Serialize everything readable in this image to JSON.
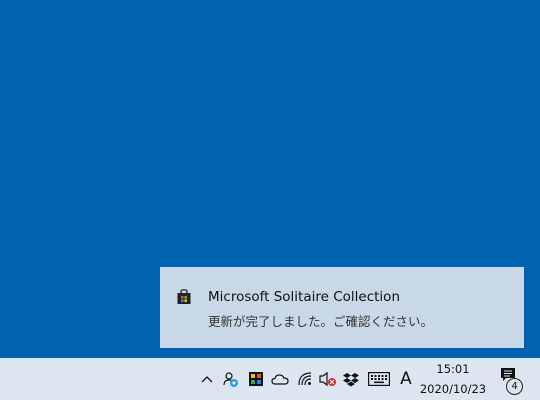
{
  "notification": {
    "app_icon": "store-bag-icon",
    "title": "Microsoft Solitaire Collection",
    "message": "更新が完了しました。ご確認ください。"
  },
  "taskbar": {
    "tray_icons": [
      "chevron-up-icon",
      "people-icon",
      "app-tile-icon",
      "onedrive-cloud-icon",
      "wifi-icon",
      "volume-muted-icon",
      "dropbox-icon",
      "touch-keyboard-icon"
    ],
    "ime_mode": "A",
    "clock": {
      "time": "15:01",
      "date": "2020/10/23"
    },
    "action_center": {
      "icon": "action-center-icon",
      "badge_count": "4"
    }
  },
  "colors": {
    "desktop": "#0063b1",
    "taskbar": "#dde6f0",
    "toast": "#c8d8e6"
  }
}
